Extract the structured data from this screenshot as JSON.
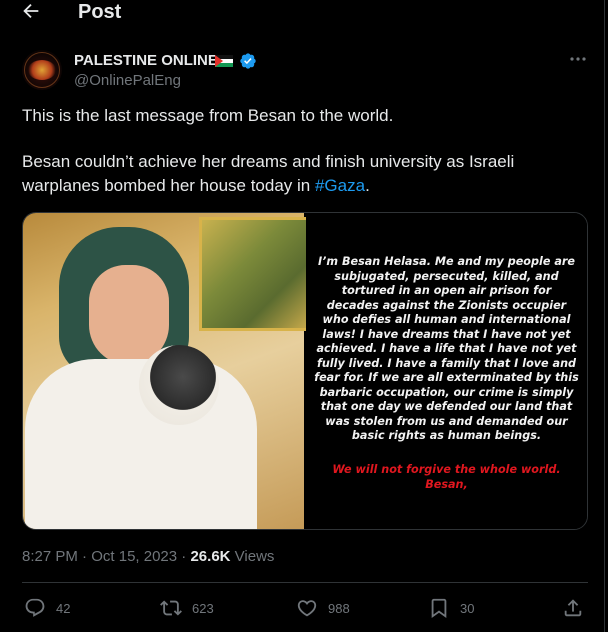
{
  "header": {
    "title": "Post",
    "back_icon": "arrow-left-icon"
  },
  "author": {
    "name": "PALESTINE ONLINE",
    "flag_icon": "palestine-flag-icon",
    "verified_icon": "verified-badge-icon",
    "handle": "@OnlinePalEng",
    "avatar_text": "PALESTINE ONLINE"
  },
  "tweet": {
    "line1": "This is the last message from Besan to the world.",
    "line2_text": "Besan couldn’t achieve her dreams and finish university as Israeli warplanes bombed her house today in ",
    "hashtag": "#Gaza",
    "line2_end": "."
  },
  "media": {
    "quote_text": "I’m Besan Helasa. Me and my people are subjugated, persecuted, killed, and tortured in an open air prison for decades against the Zionists occupier who defies all human and international laws! I have dreams that I have not yet achieved. I have a life that I have not yet fully lived. I have a family that I love and fear for. If we are all exterminated by this barbaric occupation, our crime is simply that one day we defended our land that was stolen from us and demanded our basic rights as human beings.",
    "closing_text": "We will not forgive the whole world.",
    "signature": "Besan,"
  },
  "meta": {
    "time": "8:27 PM",
    "separator": "·",
    "date": "Oct 15, 2023",
    "views_count": "26.6K",
    "views_label": "Views"
  },
  "actions": {
    "replies": "42",
    "reposts": "623",
    "likes": "988",
    "bookmarks": "30"
  },
  "colors": {
    "background": "#000000",
    "text": "#e7e9ea",
    "muted": "#71767b",
    "link": "#1d9bf0",
    "verified": "#1d9bf0",
    "divider": "#2f3336",
    "quote_red": "#e0171f"
  }
}
